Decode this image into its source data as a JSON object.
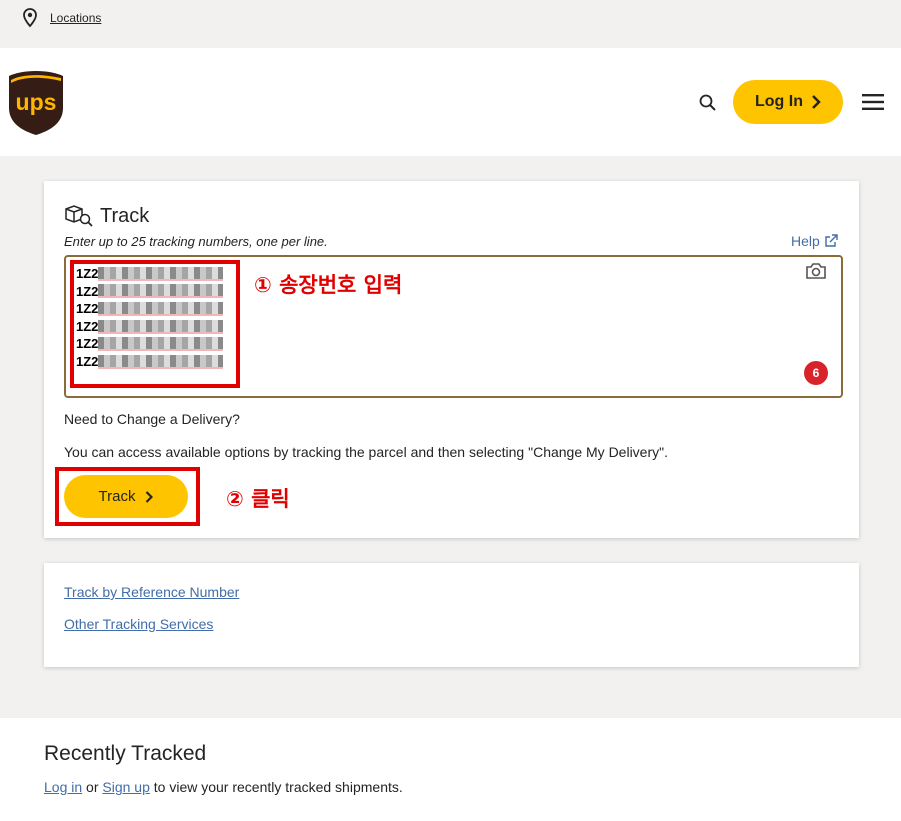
{
  "topbar": {
    "locations_label": "Locations",
    "pin_icon": "location-pin-icon"
  },
  "header": {
    "login_label": "Log In",
    "logo_text": "ups"
  },
  "track": {
    "title": "Track",
    "hint": "Enter up to 25 tracking numbers, one per line.",
    "help_label": "Help",
    "tracking_prefixes": [
      "1Z2",
      "1Z2",
      "1Z2",
      "1Z2",
      "1Z2",
      "1Z2"
    ],
    "count": "6",
    "need_change": "Need to Change a Delivery?",
    "access_text": "You can access available options by tracking the parcel and then selecting \"Change My Delivery\".",
    "button_label": "Track"
  },
  "annotations": {
    "step1": "① 송장번호 입력",
    "step2": "② 클릭"
  },
  "links": {
    "reference": "Track by Reference Number",
    "other": "Other Tracking Services"
  },
  "recent": {
    "title": "Recently Tracked",
    "login_link": "Log in",
    "or_text": "or",
    "signup_link": "Sign up",
    "suffix": "to view your recently tracked shipments."
  },
  "colors": {
    "brand_yellow": "#ffc400",
    "ups_brown": "#351c15",
    "link_blue": "#426da9",
    "annotation_red": "#e00000"
  }
}
